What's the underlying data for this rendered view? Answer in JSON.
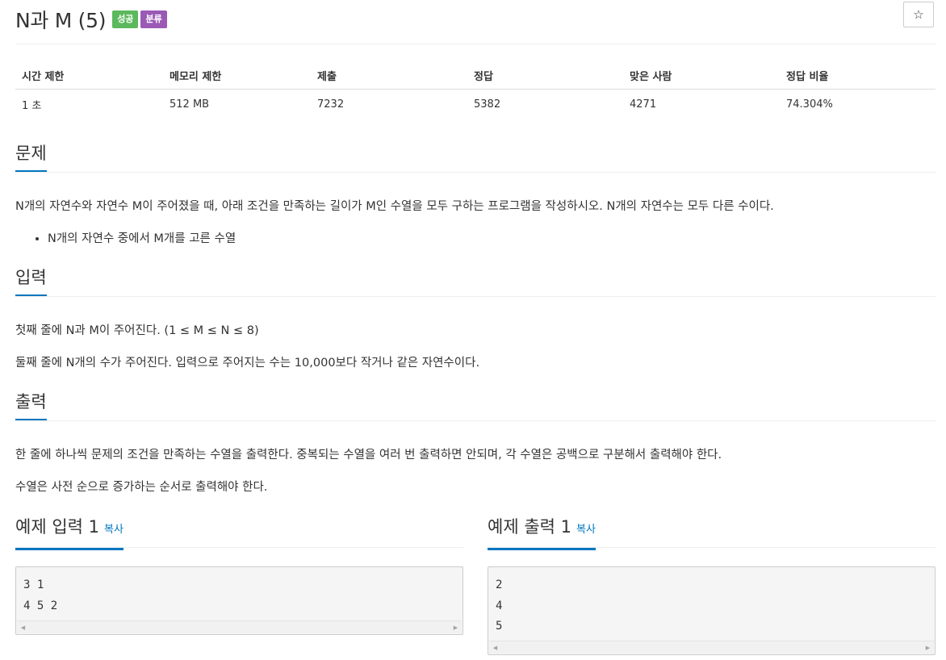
{
  "header": {
    "title": "N과 M (5)",
    "badges": {
      "success": "성공",
      "category": "분류"
    },
    "star_glyph": "☆",
    "colors": {
      "success_badge": "#5cb85c",
      "category_badge": "#9b59b6",
      "accent": "#0076c0"
    }
  },
  "info": {
    "headers": [
      "시간 제한",
      "메모리 제한",
      "제출",
      "정답",
      "맞은 사람",
      "정답 비율"
    ],
    "values": [
      "1 초",
      "512 MB",
      "7232",
      "5382",
      "4271",
      "74.304%"
    ]
  },
  "problem": {
    "heading": "문제",
    "text": "N개의 자연수와 자연수 M이 주어졌을 때, 아래 조건을 만족하는 길이가 M인 수열을 모두 구하는 프로그램을 작성하시오. N개의 자연수는 모두 다른 수이다.",
    "bullets": [
      "N개의 자연수 중에서 M개를 고른 수열"
    ]
  },
  "input": {
    "heading": "입력",
    "lines": [
      "첫째 줄에 N과 M이 주어진다. (1 ≤ M ≤ N ≤ 8)",
      "둘째 줄에 N개의 수가 주어진다. 입력으로 주어지는 수는 10,000보다 작거나 같은 자연수이다."
    ]
  },
  "output": {
    "heading": "출력",
    "lines": [
      "한 줄에 하나씩 문제의 조건을 만족하는 수열을 출력한다. 중복되는 수열을 여러 번 출력하면 안되며, 각 수열은 공백으로 구분해서 출력해야 한다.",
      "수열은 사전 순으로 증가하는 순서로 출력해야 한다."
    ]
  },
  "samples": {
    "input": {
      "heading": "예제 입력 1",
      "copy_label": "복사",
      "content": "3 1\n4 5 2"
    },
    "output": {
      "heading": "예제 출력 1",
      "copy_label": "복사",
      "content": "2\n4\n5"
    }
  }
}
